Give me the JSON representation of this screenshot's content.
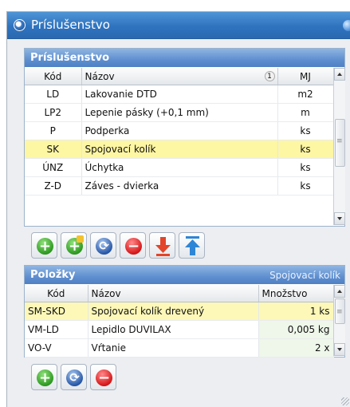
{
  "window": {
    "title": "Príslušenstvo"
  },
  "accessories": {
    "title": "Príslušenstvo",
    "columns": {
      "code": "Kód",
      "name": "Názov",
      "sort_index": "1",
      "unit": "MJ"
    },
    "rows": [
      {
        "code": "LD",
        "name": "Lakovanie DTD",
        "unit": "m2"
      },
      {
        "code": "LP2",
        "name": "Lepenie pásky (+0,1 mm)",
        "unit": "m"
      },
      {
        "code": "P",
        "name": "Podperka",
        "unit": "ks"
      },
      {
        "code": "SK",
        "name": "Spojovací kolík",
        "unit": "ks",
        "selected": true
      },
      {
        "code": "ÚNZ",
        "name": "Úchytka",
        "unit": "ks"
      },
      {
        "code": "Z-D",
        "name": "Záves - dvierka",
        "unit": "ks"
      }
    ]
  },
  "toolbar1": [
    "add-icon",
    "add-special-icon",
    "refresh-icon",
    "remove-icon",
    "move-down-icon",
    "move-up-icon"
  ],
  "items": {
    "title": "Položky",
    "subtitle": "Spojovací kolík",
    "columns": {
      "code": "Kód",
      "name": "Názov",
      "quantity": "Množstvo"
    },
    "rows": [
      {
        "code": "SM-SKD",
        "name": "Spojovací kolík drevený",
        "quantity": "1 ks",
        "selected": true
      },
      {
        "code": "VM-LD",
        "name": "Lepidlo DUVILAX",
        "quantity": "0,005 kg"
      },
      {
        "code": "VO-V",
        "name": "Vŕtanie",
        "quantity": "2 x"
      }
    ]
  },
  "toolbar2": [
    "add-icon",
    "refresh-icon",
    "remove-icon"
  ],
  "colors": {
    "title_bar": "#2f73bf",
    "panel_header": "#5f8fcf",
    "selection": "#fdf6a3"
  }
}
